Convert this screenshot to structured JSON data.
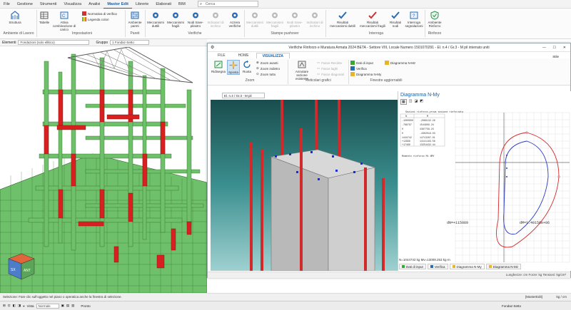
{
  "menu": {
    "tabs": [
      "File",
      "Gestione",
      "Strumenti",
      "Visualizza",
      "Analisi",
      "Master Edit",
      "Librerie",
      "Elaborati",
      "BIM"
    ],
    "active_index": 5,
    "search_placeholder": "Cerca"
  },
  "ribbon": {
    "buttons": {
      "struttura": "Struttura",
      "tabelle": "Tabelle",
      "attiva_combinazione": "Attiva combinazione di carico",
      "normativa": "Normativa di verifica",
      "legenda": "Legenda colori",
      "ambiente_pareti": "Ambiente pareti",
      "meccanismi_duttili": "Meccanismi duttili",
      "meccanismi_fragili": "Meccanismi fragili",
      "nodi_trave_pilastro": "Nodi trave-pilastro",
      "indicatori_inchino": "Indicatori di inchino",
      "azzera_verifiche": "Azzera verifiche",
      "sp_meccanismi_duttili": "Meccanismi duttili",
      "sp_meccanismi_fragili": "Meccanismi fragili",
      "sp_nodi": "Nodi trave-pilastro",
      "sp_indicatori": "Indicatori di inchino",
      "ris_meccanismi_duttili": "Risultati meccanismi duttili",
      "ris_meccanismi_fragili": "Risultati meccanismi fragili",
      "ris_nodi": "Risultati nodi",
      "interroga": "Interroga segnalazioni",
      "ambiente_rinforzo": "Ambiente Rinforzo"
    },
    "groups": {
      "ambiente": "Ambiente di Lavoro",
      "impostazioni": "Impostazioni",
      "pareti": "Pareti",
      "verifiche": "Verifiche",
      "stampe": "Stampe pushover",
      "interroga": "Interroga",
      "rinforzo": "Rinforzo"
    }
  },
  "elements_bar": {
    "label": "Elementi",
    "value": "Fondazioni (solo ellitico)",
    "group_label": "Gruppo",
    "group_value": "1 Fondaz-Setto"
  },
  "subwindow": {
    "title": "Verifiche Rinforzo e Muratura Armata 2024 BETA - Settore VIII, Locale Numero 1501070291 - El. n.4 / Gr.3 - M pil interrato uniti",
    "tabs": [
      "FILE",
      "HOME",
      "VISUALIZZA"
    ],
    "active_tab": 2,
    "style_label": "Stile",
    "ribbon": {
      "ridisegna": "Ridisegna",
      "sposta": "Sposta",
      "ruota": "Ruota",
      "zoom_avanti": "Zoom avanti",
      "zoom_indietro": "Zoom indietro",
      "zoom_tutto": "Zoom tutto",
      "annotare": "Annotare sezione esistente",
      "fasce_recinte": "Fasce Recinte",
      "fasce_laghi": "Fasce laghi",
      "fasce_diagonali": "Fasce diagonali",
      "dati_input": "Dati di input",
      "verifica": "Verifica",
      "diagramma_nmy": "Diagramma N-My",
      "diagramma_nmz": "Diagramma N-Mz",
      "group_zoom": "Zoom",
      "group_reticolari": "Reticolari grafici",
      "group_finestre": "Finestre aggiornabili"
    },
    "view_tab": "El. n.4 / Gr.3 - M pil interrato uniti",
    "diagram_title": "Diagramma N-My",
    "diagram_table_title": "Sezioni rinforzo-prova sezione rinforzata",
    "diagram_table_headers": [
      "N",
      "M"
    ],
    "diagram_rows": [
      [
        "-1000000",
        "-2069132.26"
      ],
      [
        "-786797",
        "1544909.24"
      ],
      [
        "0",
        "4387758.24"
      ],
      [
        "0",
        "-4302019.03"
      ],
      [
        "1444742",
        "14713287.01"
      ],
      [
        "+12999",
        "14111183.56"
      ],
      [
        "+17490",
        "13254432.44"
      ]
    ],
    "diagram_note": "Momento rinforzo Mi NMY",
    "dn_left": "dN=+115089",
    "dn_right": "dM=1.40156e+06",
    "info_line": "N=1044742 kg   Mv=13009.253 kg·m",
    "bottom_tabs": [
      "Dati di input",
      "Verifica",
      "Diagramma N-My",
      "Diagramma N-Mz"
    ],
    "status": "Lunghezze: cm   Forze: kg   Tensioni: kg/cm²"
  },
  "status": {
    "message": "Selezione: Fare clic sull'oggetto nel piano o operatica anche la finestra di selezione.",
    "mode": "[MasterEdit]",
    "units": "kg / cm"
  },
  "bottom": {
    "vista_label": "Vista",
    "vista_value": "Normale",
    "pronto": "Pronto",
    "right_label": "Fondaz-Setto"
  },
  "viewcube": {
    "front": "ANT",
    "side": "SX"
  },
  "colors": {
    "beam_green": "#6fc06a",
    "beam_red": "#d82020",
    "accent": "#1a5fa8"
  }
}
